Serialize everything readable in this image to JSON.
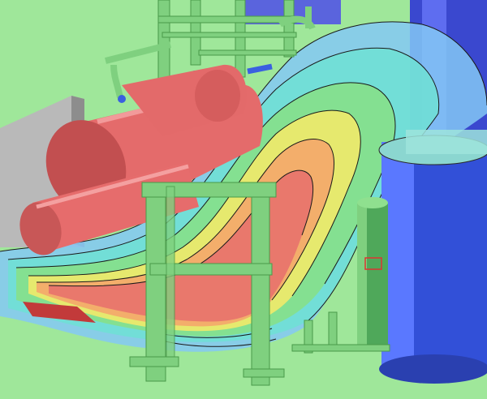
{
  "scene": {
    "description_kind": "3d-render-gas-dispersion-plant",
    "colors": {
      "ground": "#9fe79a",
      "structure": "#7fd07f",
      "structure_dark": "#5fb45f",
      "vessel": "#e66a6a",
      "vessel_shade": "#c44f50",
      "tower_blue": "#3a4ccf",
      "tower_light": "#6a7cff",
      "wall": "#b7b7b7",
      "plume_outer": "#78c8ff",
      "plume_cyan": "#66e0d8",
      "plume_green": "#7ae07a",
      "plume_yellow": "#f3ef6a",
      "plume_orange": "#f2a46a",
      "plume_red": "#e86c6c"
    },
    "icons": [
      "valve-icon",
      "pipe-elbow-icon"
    ]
  }
}
